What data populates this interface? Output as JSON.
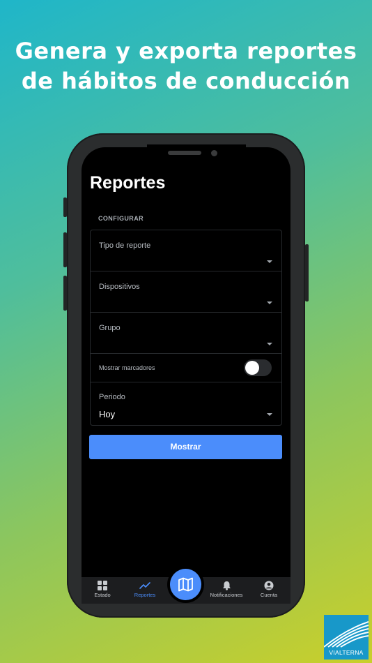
{
  "promo": {
    "headline_line1": "Genera y exporta reportes",
    "headline_line2": "de hábitos de conducción"
  },
  "screen": {
    "title": "Reportes",
    "section_label": "CONFIGURAR",
    "fields": {
      "report_type": {
        "label": "Tipo de reporte",
        "value": ""
      },
      "devices": {
        "label": "Dispositivos",
        "value": ""
      },
      "group": {
        "label": "Grupo",
        "value": ""
      },
      "markers": {
        "label": "Mostrar marcadores",
        "enabled": false
      },
      "period": {
        "label": "Periodo",
        "value": "Hoy"
      }
    },
    "submit_label": "Mostrar"
  },
  "tabbar": {
    "tabs": [
      {
        "label": "Estado",
        "icon": "grid-icon",
        "active": false
      },
      {
        "label": "Reportes",
        "icon": "trend-icon",
        "active": true
      },
      {
        "label": "Notificaciones",
        "icon": "bell-icon",
        "active": false
      },
      {
        "label": "Cuenta",
        "icon": "user-circle-icon",
        "active": false
      }
    ],
    "center_button_icon": "map-icon"
  },
  "brand": {
    "logo_text": "VIALTERNA"
  },
  "colors": {
    "accent": "#4b8dfb",
    "screen_background": "#000000",
    "tabbar_background": "#1c1d1f"
  }
}
